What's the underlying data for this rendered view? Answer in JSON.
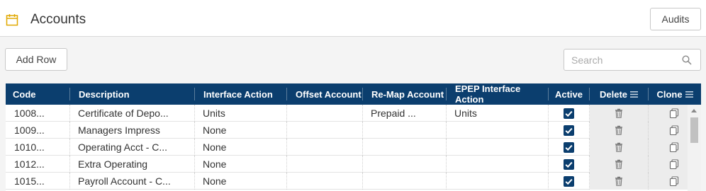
{
  "header": {
    "title": "Accounts",
    "audits_label": "Audits"
  },
  "toolbar": {
    "add_row_label": "Add Row",
    "search_placeholder": "Search"
  },
  "grid": {
    "columns": [
      "Code",
      "Description",
      "Interface Action",
      "Offset Account",
      "Re-Map Account",
      "EPEP Interface Action",
      "Active",
      "Delete",
      "Clone"
    ],
    "rows": [
      {
        "code": "1008...",
        "description": "Certificate of Depo...",
        "interface_action": "Units",
        "offset_account": "",
        "remap_account": "Prepaid ...",
        "epep_action": "Units",
        "active": true
      },
      {
        "code": "1009...",
        "description": "Managers Impress",
        "interface_action": "None",
        "offset_account": "",
        "remap_account": "",
        "epep_action": "",
        "active": true
      },
      {
        "code": "1010...",
        "description": "Operating Acct - C...",
        "interface_action": "None",
        "offset_account": "",
        "remap_account": "",
        "epep_action": "",
        "active": true
      },
      {
        "code": "1012...",
        "description": "Extra Operating",
        "interface_action": "None",
        "offset_account": "",
        "remap_account": "",
        "epep_action": "",
        "active": true
      },
      {
        "code": "1015...",
        "description": "Payroll Account - C...",
        "interface_action": "None",
        "offset_account": "",
        "remap_account": "",
        "epep_action": "",
        "active": true
      }
    ]
  },
  "colors": {
    "header_bg": "#0b3e6e",
    "accent_icon": "#e0a800",
    "checkbox": "#0b3e6e"
  },
  "icons": {
    "calendar": "calendar-icon",
    "search": "search-icon",
    "delete": "trash-icon",
    "clone": "copy-icon",
    "menu": "menu-icon"
  }
}
